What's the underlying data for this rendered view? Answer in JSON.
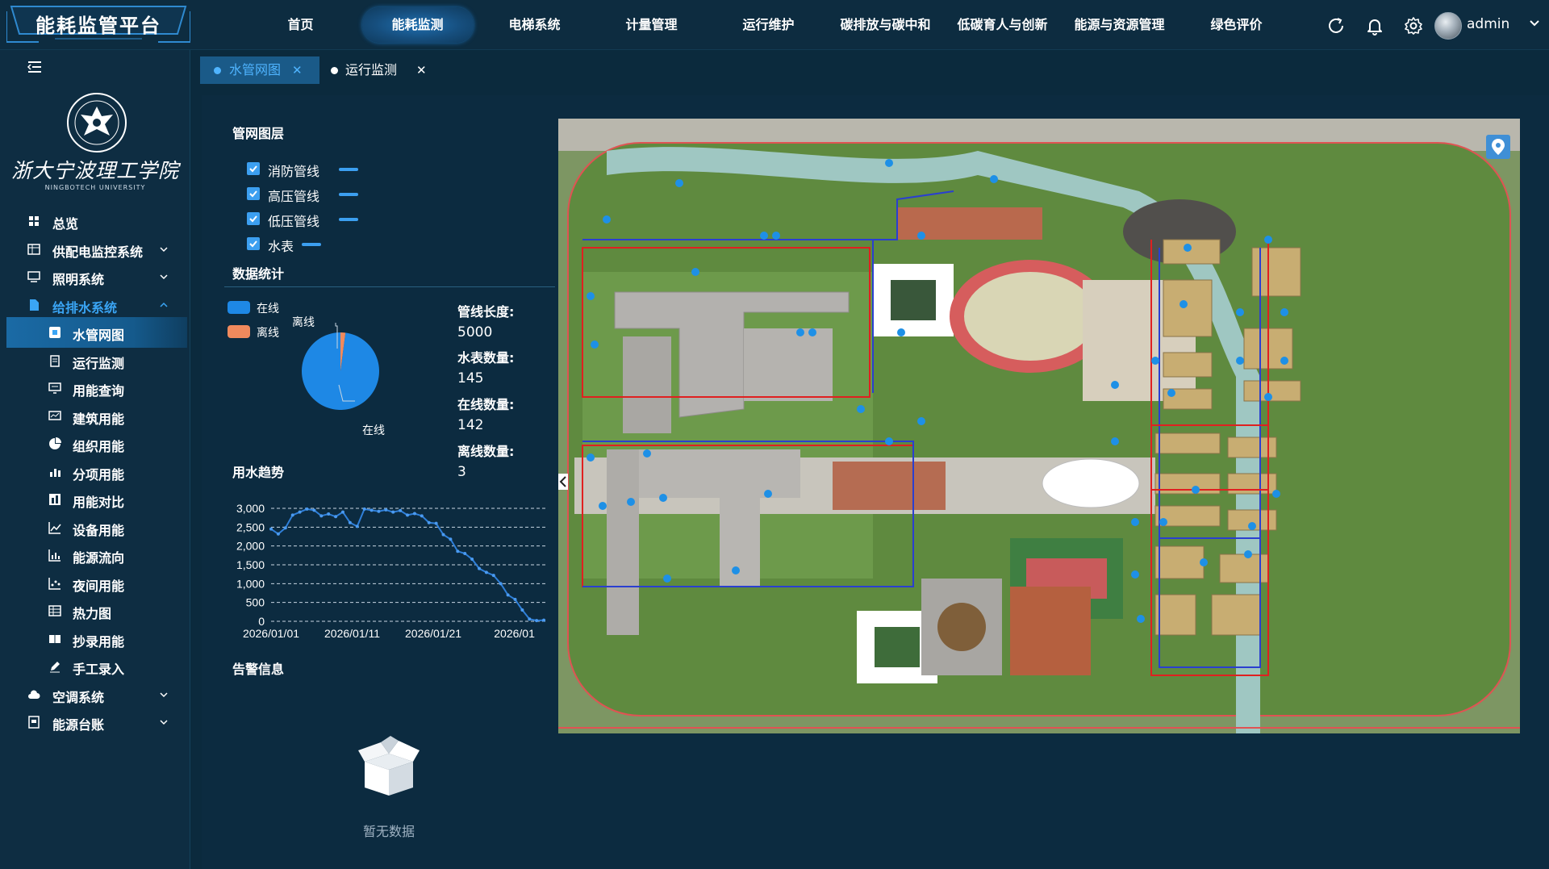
{
  "app": {
    "title": "能耗监管平台"
  },
  "nav": {
    "items": [
      "首页",
      "能耗监测",
      "电梯系统",
      "计量管理",
      "运行维护",
      "碳排放与碳中和",
      "低碳育人与创新",
      "能源与资源管理",
      "绿色评价"
    ],
    "active_index": 1
  },
  "top_actions": {
    "icons": [
      "refresh-icon",
      "bell-icon",
      "gear-icon"
    ],
    "username": "admin"
  },
  "logo": {
    "name": "浙大宁波理工学院",
    "sub": "NINGBOTECH UNIVERSITY"
  },
  "sidebar": {
    "items": [
      {
        "label": "总览",
        "icon": "grid-icon",
        "level": 1,
        "caret": false
      },
      {
        "label": "供配电监控系统",
        "icon": "table-icon",
        "level": 1,
        "caret": "down"
      },
      {
        "label": "照明系统",
        "icon": "monitor-icon",
        "level": 1,
        "caret": "down"
      },
      {
        "label": "给排水系统",
        "icon": "document-icon",
        "level": 1,
        "caret": "up",
        "open": true
      },
      {
        "label": "水管网图",
        "icon": "pipe-map-icon",
        "level": 2,
        "selected": true
      },
      {
        "label": "运行监测",
        "icon": "clipboard-icon",
        "level": 2
      },
      {
        "label": "用能查询",
        "icon": "screen-icon",
        "level": 2
      },
      {
        "label": "建筑用能",
        "icon": "chart-screen-icon",
        "level": 2
      },
      {
        "label": "组织用能",
        "icon": "pie-icon",
        "level": 2
      },
      {
        "label": "分项用能",
        "icon": "bar-icon",
        "level": 2
      },
      {
        "label": "用能对比",
        "icon": "compare-icon",
        "level": 2
      },
      {
        "label": "设备用能",
        "icon": "line-chart-icon",
        "level": 2
      },
      {
        "label": "能源流向",
        "icon": "flow-icon",
        "level": 2
      },
      {
        "label": "夜间用能",
        "icon": "scatter-icon",
        "level": 2
      },
      {
        "label": "热力图",
        "icon": "heatmap-icon",
        "level": 2
      },
      {
        "label": "抄录用能",
        "icon": "book-icon",
        "level": 2
      },
      {
        "label": "手工录入",
        "icon": "pen-icon",
        "level": 2
      },
      {
        "label": "空调系统",
        "icon": "cloud-icon",
        "level": 1,
        "caret": "down"
      },
      {
        "label": "能源台账",
        "icon": "ledger-icon",
        "level": 1,
        "caret": "down"
      }
    ]
  },
  "tabs": [
    {
      "label": "水管网图",
      "active": true
    },
    {
      "label": "运行监测",
      "active": false
    }
  ],
  "layers": {
    "title": "管网图层",
    "items": [
      {
        "label": "消防管线",
        "checked": true
      },
      {
        "label": "高压管线",
        "checked": true
      },
      {
        "label": "低压管线",
        "checked": true
      },
      {
        "label": "水表",
        "checked": true
      }
    ]
  },
  "stats": {
    "title": "数据统计",
    "legend": [
      {
        "label": "在线",
        "color": "#1e88e5"
      },
      {
        "label": "离线",
        "color": "#f08a5d"
      }
    ],
    "pie_labels": {
      "offline": "离线",
      "online": "在线"
    },
    "fields": [
      {
        "key": "管线长度:",
        "value": "5000"
      },
      {
        "key": "水表数量:",
        "value": "145"
      },
      {
        "key": "在线数量:",
        "value": "142"
      },
      {
        "key": "离线数量:",
        "value": "3"
      }
    ]
  },
  "trend": {
    "title": "用水趋势"
  },
  "chart_data": {
    "type": "line",
    "x_ticks": [
      "2026/01/01",
      "2026/01/11",
      "2026/01/21",
      "2026/01"
    ],
    "y_ticks": [
      "3,000",
      "2,500",
      "2,000",
      "1,500",
      "1,000",
      "500",
      "0"
    ],
    "ylim": [
      0,
      3000
    ],
    "grid": true,
    "series": [
      {
        "values": [
          2450,
          2320,
          2480,
          2820,
          2900,
          2980,
          2950,
          2800,
          2850,
          2780,
          2900,
          2620,
          2520,
          2980,
          2950,
          2920,
          2960,
          2900,
          2940,
          2820,
          2860,
          2800,
          2620,
          2600,
          2300,
          2180,
          1860,
          1800,
          1650,
          1400,
          1300,
          1220,
          1000,
          700,
          580,
          300,
          60,
          20,
          30
        ]
      }
    ]
  },
  "alerts": {
    "title": "告警信息",
    "empty_text": "暂无数据"
  },
  "colors": {
    "accent": "#3c9ff0",
    "active_nav": "#1b6cb2",
    "background": "#0b2a3d"
  }
}
